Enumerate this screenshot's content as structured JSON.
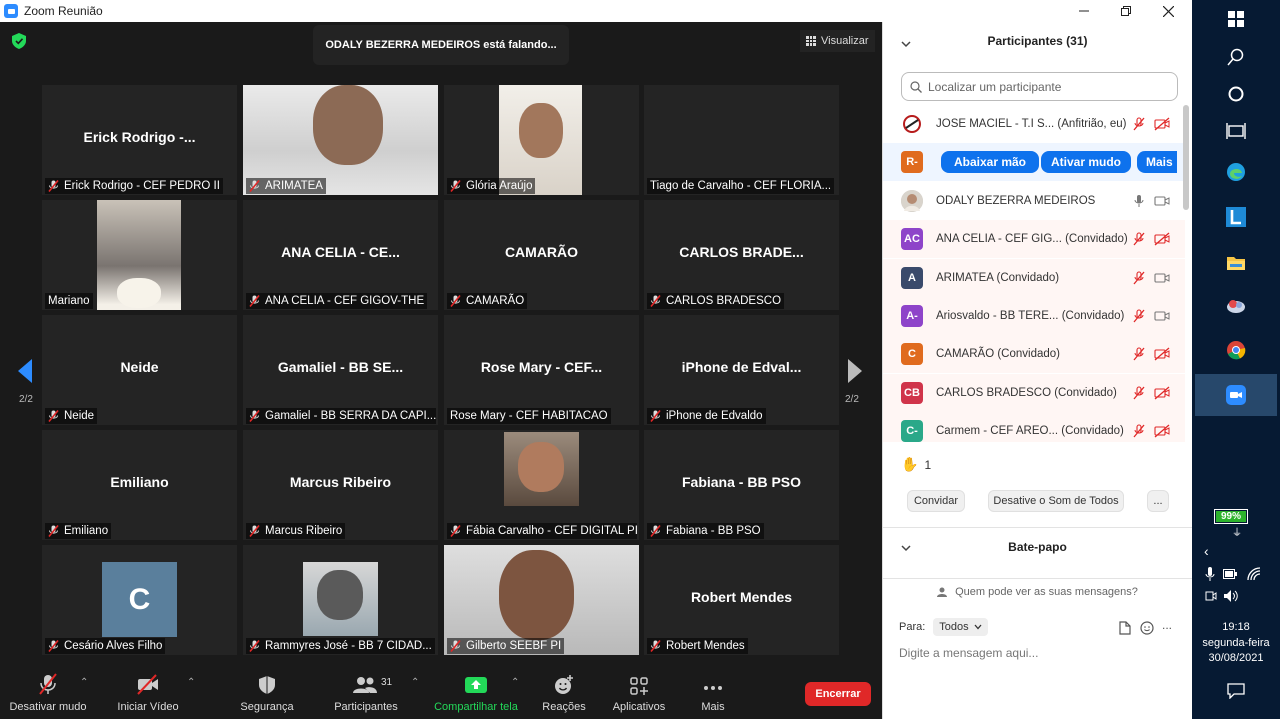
{
  "window": {
    "title": "Zoom Reunião"
  },
  "meeting": {
    "speaking": "ODALY BEZERRA MEDEIROS está falando...",
    "view_label": "Visualizar",
    "page_left": "2/2",
    "page_right": "2/2"
  },
  "tiles": [
    {
      "big": "Erick  Rodrigo -...",
      "label": "Erick Rodrigo - CEF PEDRO II",
      "muted": true
    },
    {
      "big": "",
      "label": "ARIMATEA",
      "muted": true
    },
    {
      "big": "",
      "label": "Glória Araújo",
      "muted": true
    },
    {
      "big": "",
      "label": "Tiago de Carvalho - CEF FLORIA...",
      "muted": false
    },
    {
      "big": "",
      "label": "Mariano",
      "muted": false
    },
    {
      "big": "ANA CELIA - CE...",
      "label": "ANA CELIA - CEF GIGOV-THE",
      "muted": true
    },
    {
      "big": "CAMARÃO",
      "label": "CAMARÃO",
      "muted": true
    },
    {
      "big": "CARLOS  BRADE...",
      "label": "CARLOS BRADESCO",
      "muted": true
    },
    {
      "big": "Neide",
      "label": "Neide",
      "muted": true
    },
    {
      "big": "Gamaliel - BB SE...",
      "label": "Gamaliel - BB SERRA DA CAPI...",
      "muted": true
    },
    {
      "big": "Rose Mary - CEF...",
      "label": "Rose Mary - CEF HABITACAO",
      "muted": false
    },
    {
      "big": "iPhone  de  Edval...",
      "label": "iPhone de Edvaldo",
      "muted": true
    },
    {
      "big": "Emiliano",
      "label": "Emiliano",
      "muted": true
    },
    {
      "big": "Marcus Ribeiro",
      "label": "Marcus Ribeiro",
      "muted": true
    },
    {
      "big": "",
      "label": "Fábia Carvalho - CEF DIGITAL PI",
      "muted": true
    },
    {
      "big": "Fabiana - BB PSO",
      "label": "Fabiana - BB PSO",
      "muted": true
    },
    {
      "big": "",
      "label": "Cesário Alves Filho",
      "muted": true,
      "avatar_letter": "C"
    },
    {
      "big": "",
      "label": "Rammyres José - BB 7 CIDAD...",
      "muted": true
    },
    {
      "big": "",
      "label": "Gilberto SEEBF PI",
      "muted": true
    },
    {
      "big": "Robert Mendes",
      "label": "Robert Mendes",
      "muted": true
    }
  ],
  "toolbar": {
    "mute": "Desativar mudo",
    "video": "Iniciar Vídeo",
    "security": "Segurança",
    "participants": "Participantes",
    "participants_count": "31",
    "share": "Compartilhar tela",
    "reactions": "Reações",
    "apps": "Aplicativos",
    "more": "Mais",
    "end": "Encerrar"
  },
  "panel": {
    "title": "Participantes (31)",
    "search_placeholder": "Localizar um participante",
    "participants": [
      {
        "avatar": "",
        "name": "JOSE MACIEL - T.I S... (Anfitrião, eu)",
        "color": "#ffffff"
      },
      {
        "avatar": "R-",
        "name": "",
        "color": "#e06b1e"
      },
      {
        "avatar": "",
        "name": "ODALY BEZERRA MEDEIROS",
        "color": "#cccccc"
      },
      {
        "avatar": "AC",
        "name": "ANA CELIA - CEF GIG... (Convidado)",
        "color": "#8e44c9"
      },
      {
        "avatar": "A",
        "name": "ARIMATEA (Convidado)",
        "color": "#3a4a6b"
      },
      {
        "avatar": "A-",
        "name": "Ariosvaldo - BB TERE... (Convidado)",
        "color": "#8e44c9"
      },
      {
        "avatar": "C",
        "name": "CAMARÃO (Convidado)",
        "color": "#e06b1e"
      },
      {
        "avatar": "CB",
        "name": "CARLOS BRADESCO (Convidado)",
        "color": "#d0344a"
      },
      {
        "avatar": "C-",
        "name": "Carmem - CEF AREO... (Convidado)",
        "color": "#2aa889"
      }
    ],
    "row_actions": {
      "lower_hand": "Abaixar mão",
      "mute": "Ativar mudo",
      "more": "Mais"
    },
    "hand_count": "1",
    "invite": "Convidar",
    "mute_all": "Desative o Som de Todos",
    "more_dots": "...",
    "chat_title": "Bate-papo",
    "chat_info": "Quem pode ver as suas mensagens?",
    "chat_to_label": "Para:",
    "chat_to_value": "Todos",
    "chat_more": "...",
    "chat_placeholder": "Digite a mensagem aqui..."
  },
  "taskbar": {
    "battery": "99%",
    "time": "19:18",
    "day": "segunda-feira",
    "date": "30/08/2021"
  }
}
